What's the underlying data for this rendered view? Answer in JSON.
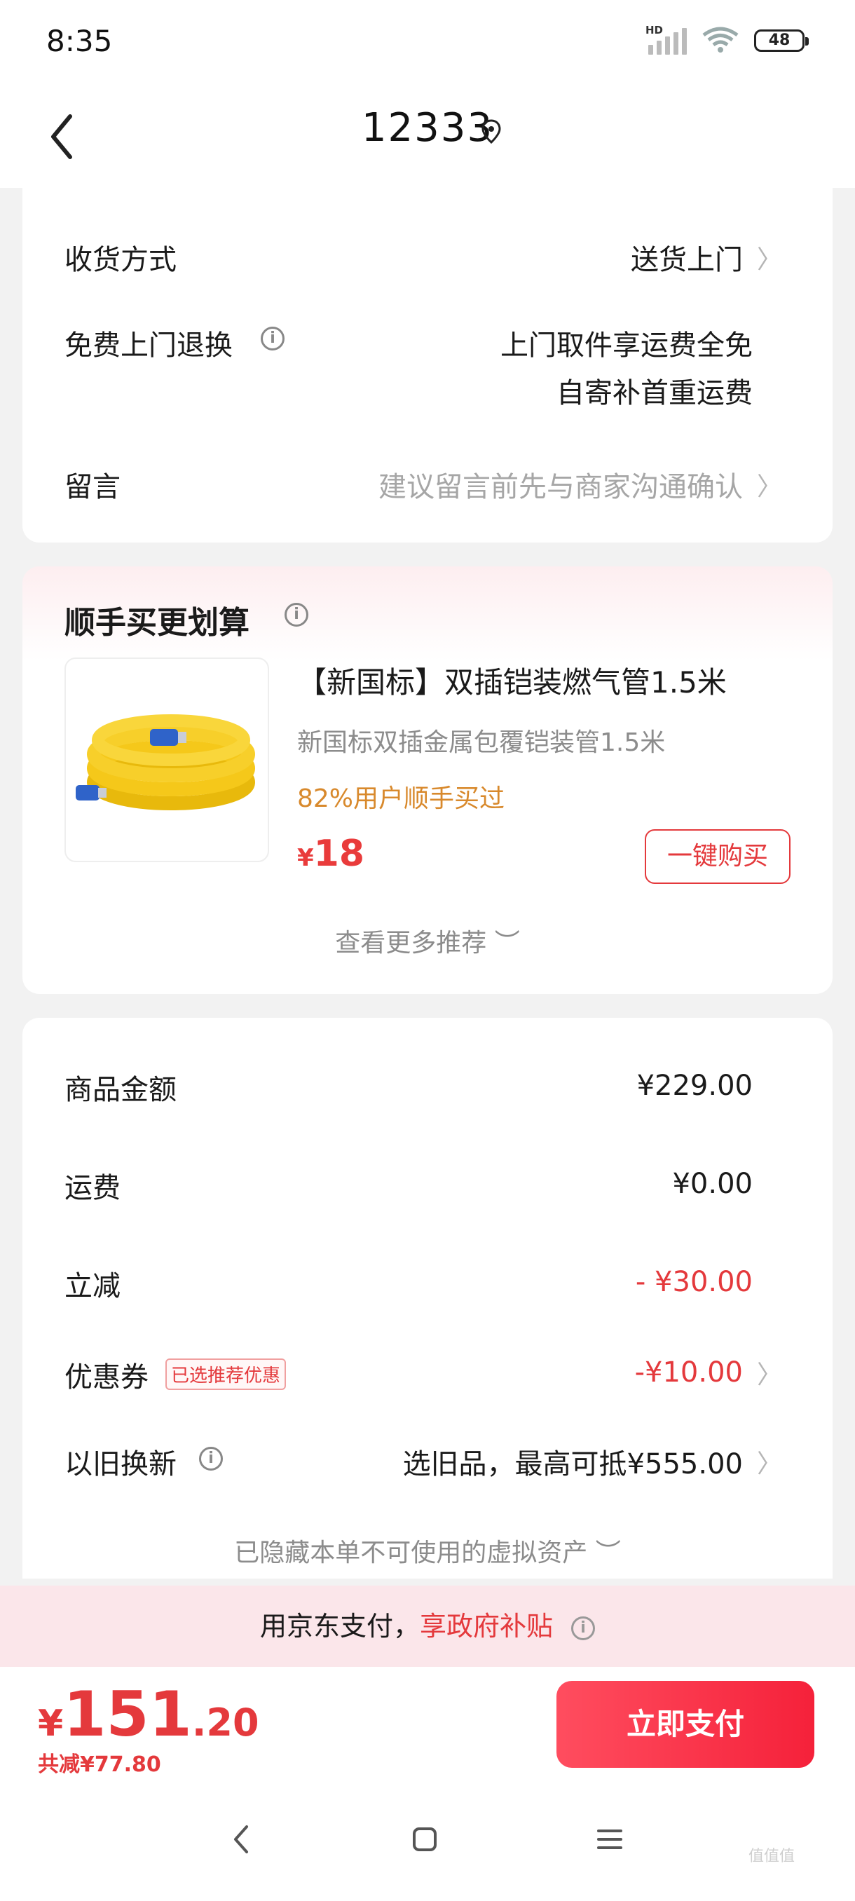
{
  "status_bar": {
    "time": "8:35",
    "signal_label": "HD",
    "battery": "48"
  },
  "header": {
    "title": "12333"
  },
  "delivery": {
    "method_label": "收货方式",
    "method_value": "送货上门",
    "free_return_label": "免费上门退换",
    "free_return_line1": "上门取件享运费全免",
    "free_return_line2": "自寄补首重运费",
    "message_label": "留言",
    "message_placeholder": "建议留言前先与商家沟通确认"
  },
  "recommend": {
    "title": "顺手买更划算",
    "product_name": "【新国标】双插铠装燃气管1.5米",
    "product_sub": "新国标双插金属包覆铠装管1.5米",
    "product_tag": "82%用户顺手买过",
    "price_symbol": "¥",
    "price": "18",
    "buy_label": "一键购买",
    "more_label": "查看更多推荐"
  },
  "summary": {
    "rows": [
      {
        "label": "商品金额",
        "value": "¥229.00"
      },
      {
        "label": "运费",
        "value": "¥0.00"
      },
      {
        "label": "立减",
        "value": "- ¥30.00"
      },
      {
        "label": "优惠券",
        "value": "-¥10.00",
        "badge": "已选推荐优惠"
      },
      {
        "label": "以旧换新",
        "value": "选旧品，最高可抵¥555.00"
      }
    ],
    "hidden_assets": "已隐藏本单不可使用的虚拟资产"
  },
  "subsidy": {
    "prefix": "用京东支付，",
    "highlight": "享政府补贴"
  },
  "footer": {
    "currency": "¥",
    "total_int": "151",
    "total_dec": ".20",
    "saved": "共减¥77.80",
    "pay_label": "立即支付"
  },
  "watermark": "值值值",
  "colors": {
    "accent": "#e4393c",
    "tag": "#d8892c",
    "subsidy_bg": "#fbe6ea"
  }
}
